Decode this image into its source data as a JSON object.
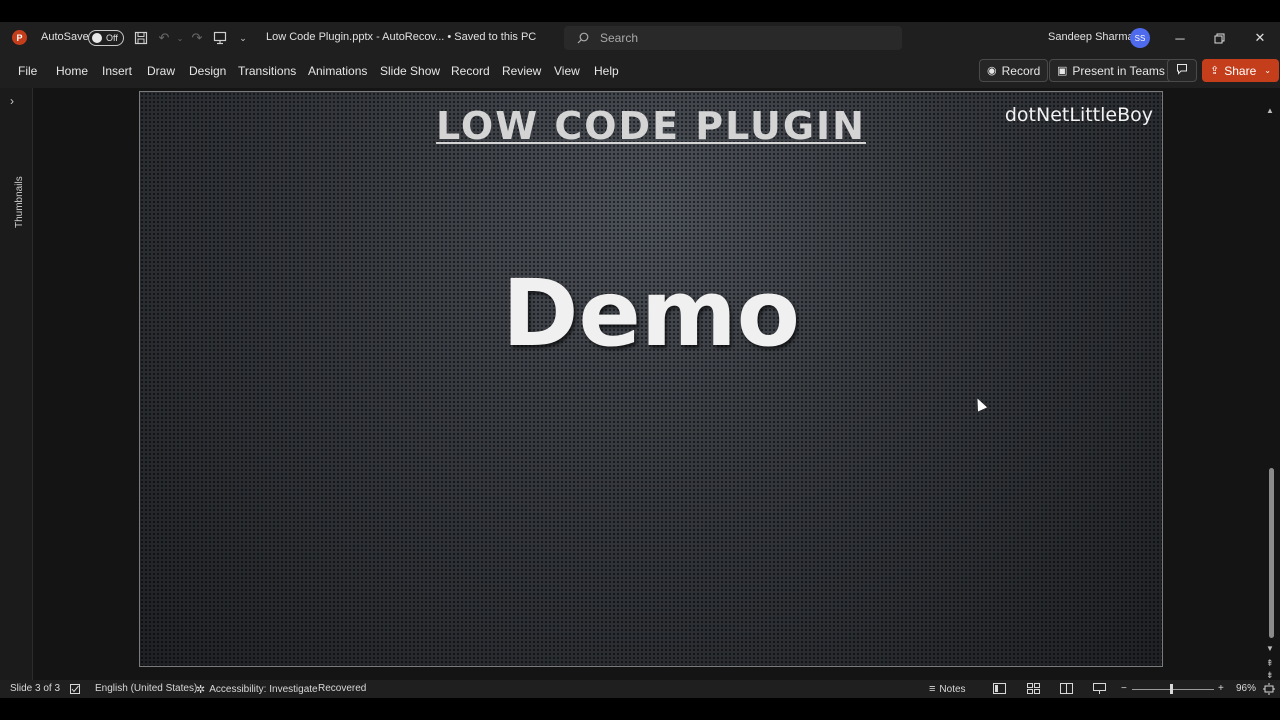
{
  "titlebar": {
    "app_logo": "P",
    "autosave_label": "AutoSave",
    "autosave_state": "Off",
    "doc_title": "Low Code Plugin.pptx  -  AutoRecov...  • Saved to this PC",
    "search_placeholder": "Search",
    "user_name": "Sandeep Sharma",
    "user_initials": "SS"
  },
  "ribbon": {
    "tabs": [
      "File",
      "Home",
      "Insert",
      "Draw",
      "Design",
      "Transitions",
      "Animations",
      "Slide Show",
      "Record",
      "Review",
      "View",
      "Help"
    ],
    "record_button": "Record",
    "present_button": "Present in Teams",
    "share_button": "Share"
  },
  "thumbnails": {
    "label": "Thumbnails"
  },
  "slide": {
    "title": "LOW CODE PLUGIN",
    "brand": "dotNetLittleBoy",
    "main_text": "Demo"
  },
  "statusbar": {
    "slide_position": "Slide 3 of 3",
    "language": "English (United States)",
    "accessibility": "Accessibility: Investigate",
    "recovered": "Recovered",
    "notes": "Notes",
    "zoom": "96%"
  },
  "colors": {
    "accent": "#c43e1c",
    "avatar": "#4f6bed",
    "chrome": "#1f1f1f"
  }
}
